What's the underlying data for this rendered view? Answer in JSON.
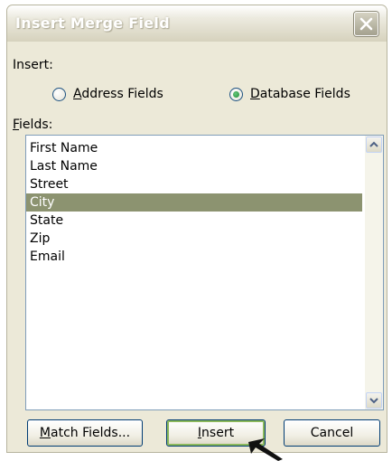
{
  "window": {
    "title": "Insert Merge Field"
  },
  "insert_group": {
    "label": "Insert:",
    "options": [
      {
        "accel": "A",
        "rest": "ddress Fields",
        "selected": false
      },
      {
        "accel": "D",
        "rest": "atabase Fields",
        "selected": true
      }
    ]
  },
  "fields": {
    "label_accel": "F",
    "label_rest": "ields:",
    "items": [
      "First Name",
      "Last Name",
      "Street",
      "City",
      "State",
      "Zip",
      "Email"
    ],
    "selected": "City"
  },
  "buttons": {
    "match_accel": "M",
    "match_rest": "atch Fields...",
    "insert_accel": "I",
    "insert_rest": "nsert",
    "cancel": "Cancel"
  },
  "colors": {
    "selection": "#8c9370",
    "dialog_bg": "#ece9d8"
  },
  "icons": {
    "close": "close-icon",
    "scroll_up": "chevron-up-icon",
    "scroll_down": "chevron-down-icon",
    "cursor": "mouse-pointer-icon"
  }
}
